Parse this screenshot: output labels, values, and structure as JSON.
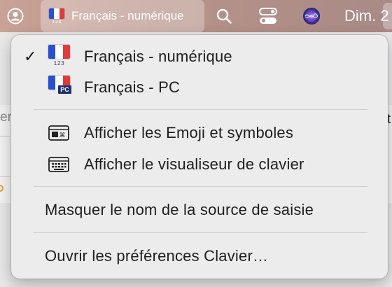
{
  "menubar": {
    "input_source_label": "Français - numérique",
    "input_source_flag_caption": "123",
    "clock_label": "Dim. 2"
  },
  "menu": {
    "sources": [
      {
        "label": "Français - numérique",
        "checked": true,
        "check_glyph": "✓",
        "badge": "123"
      },
      {
        "label": "Français - PC",
        "checked": false,
        "badge": "PC"
      }
    ],
    "viewer_items": [
      {
        "label": "Afficher les Emoji et symboles",
        "icon": "emoji-symbols-icon"
      },
      {
        "label": "Afficher le visualiseur de clavier",
        "icon": "keyboard-icon"
      }
    ],
    "hide_name_label": "Masquer le nom de la source de saisie",
    "open_prefs_label": "Ouvrir les préférences Clavier…"
  },
  "background_app": {
    "left_fragment": "er",
    "right_fragment": "t"
  },
  "colors": {
    "menubar_gradient_start": "#c8a296",
    "menu_background": "#ececec",
    "flag_blue": "#2b4fd1",
    "flag_red": "#e03a3a"
  }
}
